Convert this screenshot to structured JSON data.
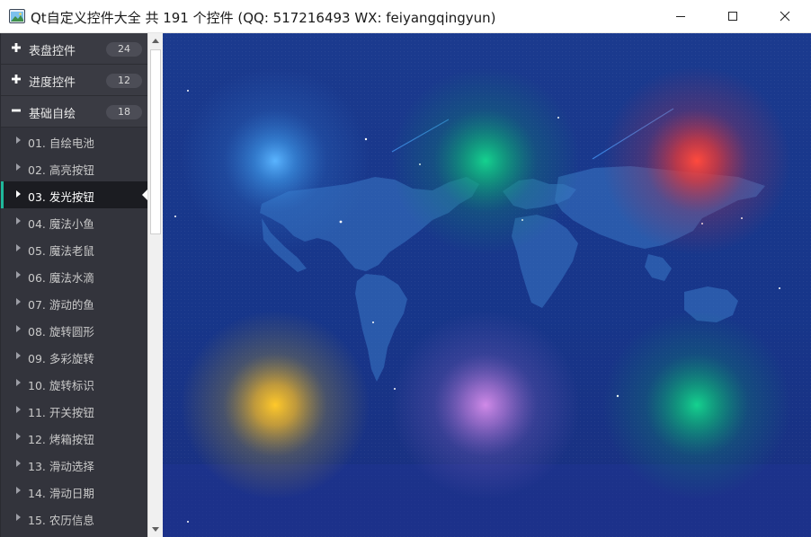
{
  "window": {
    "title": "Qt自定义控件大全 共 191 个控件 (QQ: 517216493 WX: feiyangqingyun)",
    "buttons": [
      "minimize-icon",
      "maximize-icon",
      "close-icon"
    ]
  },
  "sidebar": {
    "categories": [
      {
        "label": "表盘控件",
        "count": "24",
        "icon": "plus-icon",
        "expanded": false
      },
      {
        "label": "进度控件",
        "count": "12",
        "icon": "plus-icon",
        "expanded": false
      },
      {
        "label": "基础自绘",
        "count": "18",
        "icon": "minus-icon",
        "expanded": true
      }
    ],
    "items": [
      {
        "label": "01. 自绘电池"
      },
      {
        "label": "02. 高亮按钮"
      },
      {
        "label": "03. 发光按钮",
        "selected": true
      },
      {
        "label": "04. 魔法小鱼"
      },
      {
        "label": "05. 魔法老鼠"
      },
      {
        "label": "06. 魔法水滴"
      },
      {
        "label": "07. 游动的鱼"
      },
      {
        "label": "08. 旋转圆形"
      },
      {
        "label": "09. 多彩旋转"
      },
      {
        "label": "10. 旋转标识"
      },
      {
        "label": "11. 开关按钮"
      },
      {
        "label": "12. 烤箱按钮"
      },
      {
        "label": "13. 滑动选择"
      },
      {
        "label": "14. 滑动日期"
      },
      {
        "label": "15. 农历信息"
      }
    ],
    "accent_color": "#1fb89b"
  },
  "main": {
    "background": "world-map",
    "glow_buttons": [
      {
        "name": "blue",
        "color": "#4aa3f0"
      },
      {
        "name": "green",
        "color": "#12c98a"
      },
      {
        "name": "red",
        "color": "#f03a3a"
      },
      {
        "name": "yellow",
        "color": "#f5c22a"
      },
      {
        "name": "purple",
        "color": "#c77fe0"
      },
      {
        "name": "green",
        "color": "#12c98a"
      }
    ]
  }
}
